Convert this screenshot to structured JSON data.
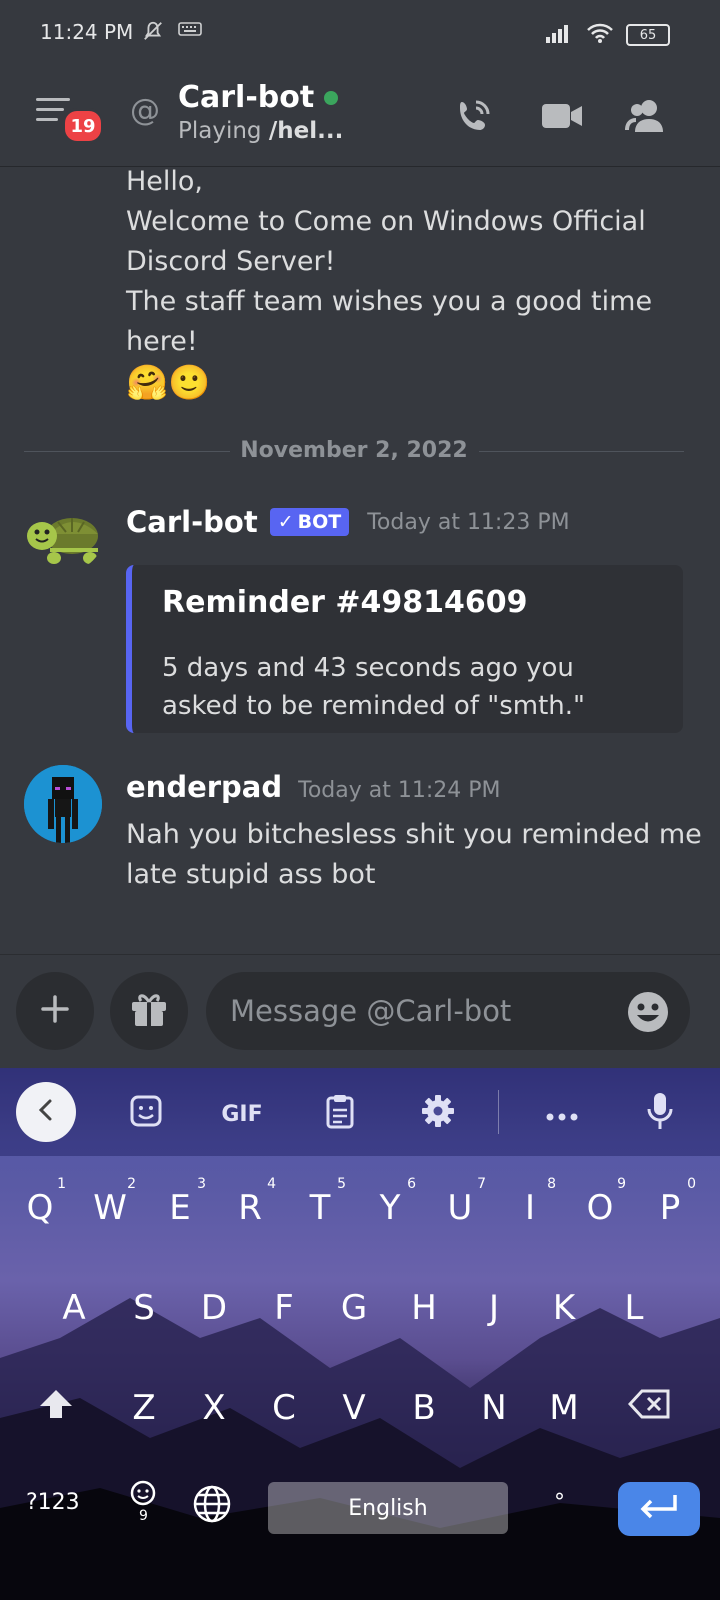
{
  "status_bar": {
    "time": "11:24 PM",
    "battery": "65"
  },
  "header": {
    "unread_count": "19",
    "dm_name": "Carl-bot",
    "status_prefix": "Playing ",
    "status_activity": "/hel...",
    "online_color": "#3ba55d"
  },
  "messages": {
    "previous_lines": [
      "Hello,",
      "Welcome to Come on Windows Official",
      "Discord Server!",
      "The staff team wishes you a good time",
      "here!"
    ],
    "previous_emoji": "🤗🙂",
    "date_divider": "November 2, 2022",
    "bot_message": {
      "author": "Carl-bot",
      "tag": "BOT",
      "timestamp": "Today at 11:23 PM",
      "embed_title": "Reminder #49814609",
      "embed_desc_line1": "5 days and 43 seconds ago you",
      "embed_desc_line2": "asked to be reminded of \"smth.\""
    },
    "user_message": {
      "author": "enderpad",
      "timestamp": "Today at 11:24 PM",
      "line1": "Nah you bitchesless shit you reminded me",
      "line2": "late stupid ass bot"
    }
  },
  "input": {
    "placeholder": "Message @Carl-bot"
  },
  "keyboard": {
    "toolbar": [
      "back",
      "sticker",
      "GIF",
      "clipboard",
      "settings",
      "more",
      "mic"
    ],
    "row1": [
      {
        "k": "Q",
        "n": "1"
      },
      {
        "k": "W",
        "n": "2"
      },
      {
        "k": "E",
        "n": "3"
      },
      {
        "k": "R",
        "n": "4"
      },
      {
        "k": "T",
        "n": "5"
      },
      {
        "k": "Y",
        "n": "6"
      },
      {
        "k": "U",
        "n": "7"
      },
      {
        "k": "I",
        "n": "8"
      },
      {
        "k": "O",
        "n": "9"
      },
      {
        "k": "P",
        "n": "0"
      }
    ],
    "row2": [
      "A",
      "S",
      "D",
      "F",
      "G",
      "H",
      "J",
      "K",
      "L"
    ],
    "row3": [
      "Z",
      "X",
      "C",
      "V",
      "B",
      "N",
      "M"
    ],
    "symbols_label": "?123",
    "space_label": "English",
    "period_label": "°",
    "gif_label": "GIF"
  }
}
